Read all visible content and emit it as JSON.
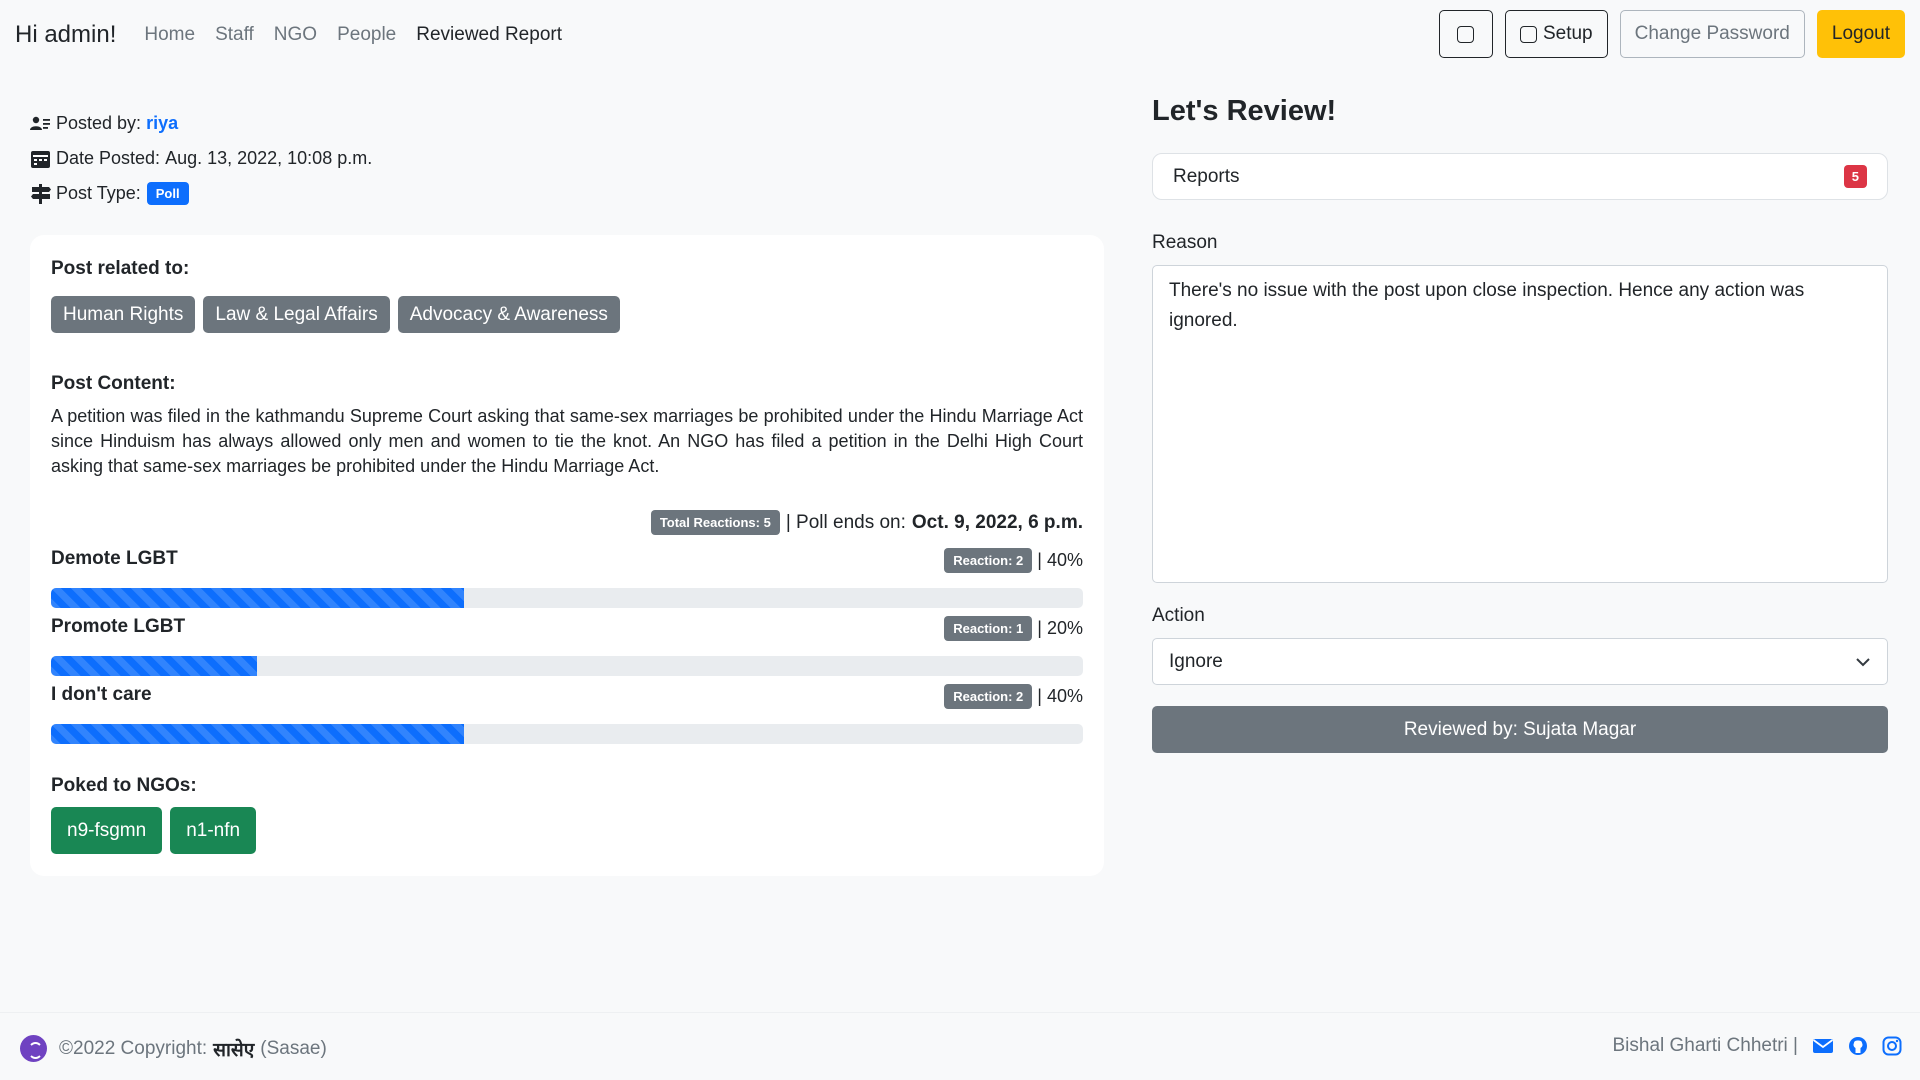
{
  "nav": {
    "brand": "Hi admin!",
    "links": [
      "Home",
      "Staff",
      "NGO",
      "People",
      "Reviewed Report"
    ],
    "setup_label": "Setup",
    "change_password_label": "Change Password",
    "logout_label": "Logout"
  },
  "post": {
    "posted_by_label": "Posted by:",
    "author": "riya",
    "date_label": "Date Posted:",
    "date_value": "Aug. 13, 2022, 10:08 p.m.",
    "type_label": "Post Type:",
    "type_value": "Poll",
    "related_label": "Post related to:",
    "tags": [
      "Human Rights",
      "Law & Legal Affairs",
      "Advocacy & Awareness"
    ],
    "content_label": "Post Content:",
    "content": "A petition was filed in the kathmandu Supreme Court asking that same-sex marriages be prohibited under the Hindu Marriage Act since Hinduism has always allowed only men and women to tie the knot. An NGO has filed a petition in the Delhi High Court asking that same-sex marriages be prohibited under the Hindu Marriage Act.",
    "total_reactions": "Total Reactions: 5",
    "poll_ends_label": "| Poll ends on:",
    "poll_ends_date": "Oct. 9, 2022, 6 p.m.",
    "options": [
      {
        "label": "Demote LGBT",
        "reaction": "Reaction: 2",
        "percent": "| 40%",
        "fraction": 0.4
      },
      {
        "label": "Promote LGBT",
        "reaction": "Reaction: 1",
        "percent": "| 20%",
        "fraction": 0.2
      },
      {
        "label": "I don't care",
        "reaction": "Reaction: 2",
        "percent": "| 40%",
        "fraction": 0.4
      }
    ],
    "poked_label": "Poked to NGOs:",
    "ngos": [
      "n9-fsgmn",
      "n1-nfn"
    ]
  },
  "review": {
    "title": "Let's Review!",
    "reports_label": "Reports",
    "reports_count": "5",
    "reason_label": "Reason",
    "reason_text": "There's no issue with the post upon close inspection. Hence any action was ignored.",
    "action_label": "Action",
    "action_value": "Ignore",
    "reviewed_by": "Reviewed by: Sujata Magar"
  },
  "footer": {
    "copyright_prefix": "©2022 Copyright:",
    "brand_devanagari": "सासेए",
    "brand_latin": "(Sasae)",
    "author": "Bishal Gharti Chhetri |"
  },
  "colors": {
    "primary": "#0d6efd",
    "success": "#198754",
    "secondary": "#6c757d",
    "warning": "#ffc107",
    "danger": "#dc3545"
  }
}
